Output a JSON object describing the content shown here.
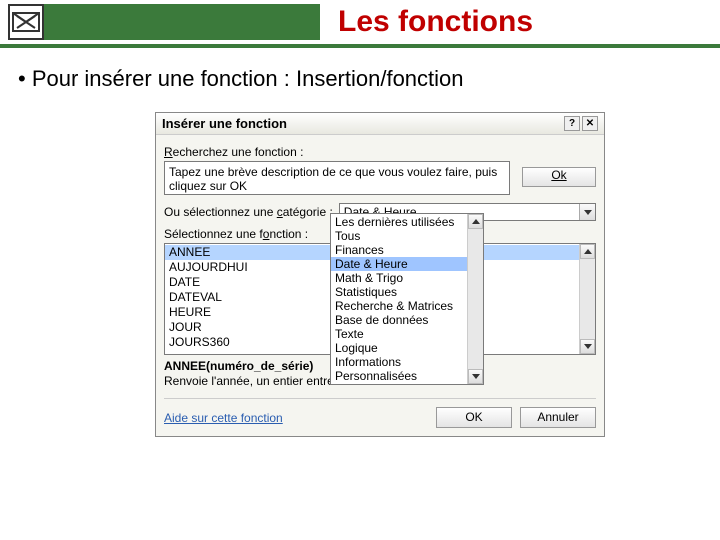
{
  "header": {
    "title": "Les fonctions"
  },
  "bullet": "• Pour insérer une fonction : Insertion/fonction",
  "dialog": {
    "title": "Insérer une fonction",
    "help_char": "?",
    "close_char": "✕",
    "search_label_pre": "R",
    "search_label_mid": "echerchez une fonction :",
    "search_text": "Tapez une brève description de ce que vous voulez faire, puis cliquez sur OK",
    "ok_top": "Ok",
    "cat_label_pre": "Ou sélectionnez une ",
    "cat_label_u": "c",
    "cat_label_post": "atégorie :",
    "cat_value": "Date & Heure",
    "sel_label_pre": "Sélectionnez une f",
    "sel_label_u": "o",
    "sel_label_post": "nction :",
    "functions": [
      "ANNEE",
      "AUJOURDHUI",
      "DATE",
      "DATEVAL",
      "HEURE",
      "JOUR",
      "JOURS360"
    ],
    "signature": "ANNEE(numéro_de_série)",
    "description": "Renvoie l'année, un entier entre",
    "help_link": "Aide sur cette fonction",
    "ok_btn": "OK",
    "cancel_btn": "Annuler",
    "dropdown": [
      "Les dernières utilisées",
      "Tous",
      "Finances",
      "Date & Heure",
      "Math & Trigo",
      "Statistiques",
      "Recherche & Matrices",
      "Base de données",
      "Texte",
      "Logique",
      "Informations",
      "Personnalisées"
    ]
  }
}
